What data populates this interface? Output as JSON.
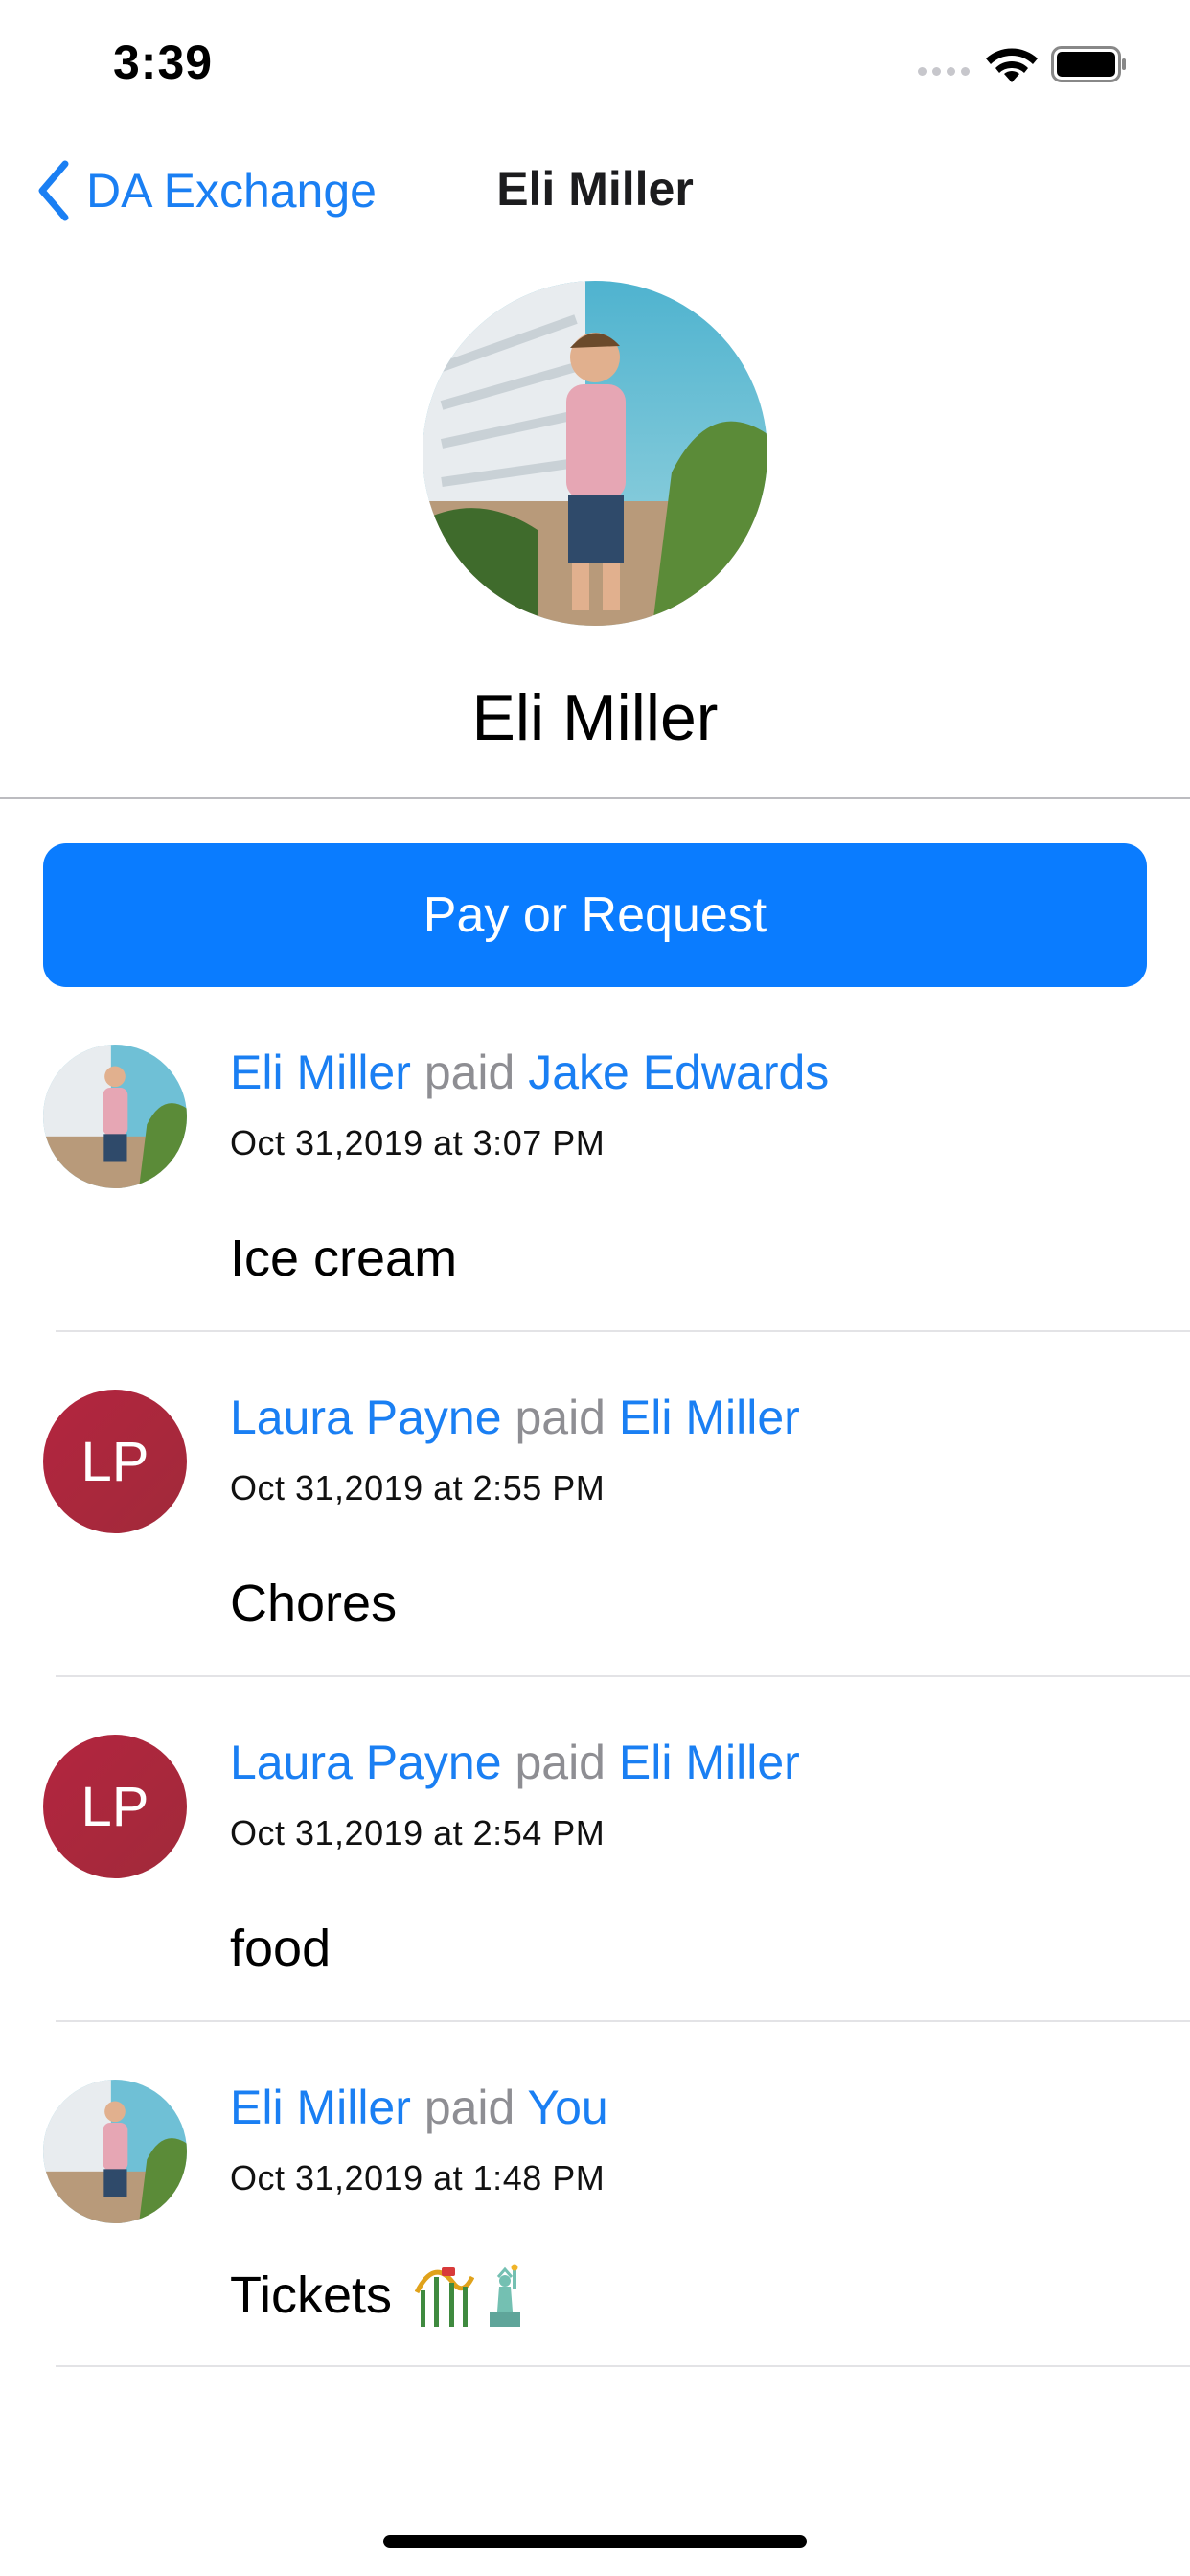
{
  "status_bar": {
    "time": "3:39",
    "signal_icon": "cellular-dots-icon",
    "wifi_icon": "wifi-icon",
    "battery_icon": "battery-full-icon"
  },
  "nav": {
    "back_label": "DA Exchange",
    "title": "Eli Miller",
    "back_icon": "chevron-left-icon"
  },
  "profile": {
    "name": "Eli Miller",
    "avatar": "profile-photo"
  },
  "pay_button": {
    "label": "Pay or Request"
  },
  "colors": {
    "accent": "#0a7cff",
    "link": "#1a7ff3",
    "muted": "#8e8e93",
    "initials_bg": "#b3253f"
  },
  "feed": [
    {
      "avatar_type": "photo",
      "initials": "",
      "payer": "Eli Miller",
      "verb": "paid",
      "payee": "Jake Edwards",
      "date": "Oct 31,2019 at 3:07 PM",
      "note": "Ice cream"
    },
    {
      "avatar_type": "initials",
      "initials": "LP",
      "payer": "Laura Payne",
      "verb": "paid",
      "payee": "Eli Miller",
      "date": "Oct 31,2019 at 2:55 PM",
      "note": "Chores"
    },
    {
      "avatar_type": "initials",
      "initials": "LP",
      "payer": "Laura Payne",
      "verb": "paid",
      "payee": "Eli Miller",
      "date": "Oct 31,2019 at 2:54 PM",
      "note": "food"
    },
    {
      "avatar_type": "photo",
      "initials": "",
      "payer": "Eli Miller",
      "verb": "paid",
      "payee": "You",
      "date": "Oct 31,2019 at 1:48 PM",
      "note": "Tickets",
      "note_icons": [
        "roller-coaster-icon",
        "statue-of-liberty-icon"
      ]
    }
  ]
}
